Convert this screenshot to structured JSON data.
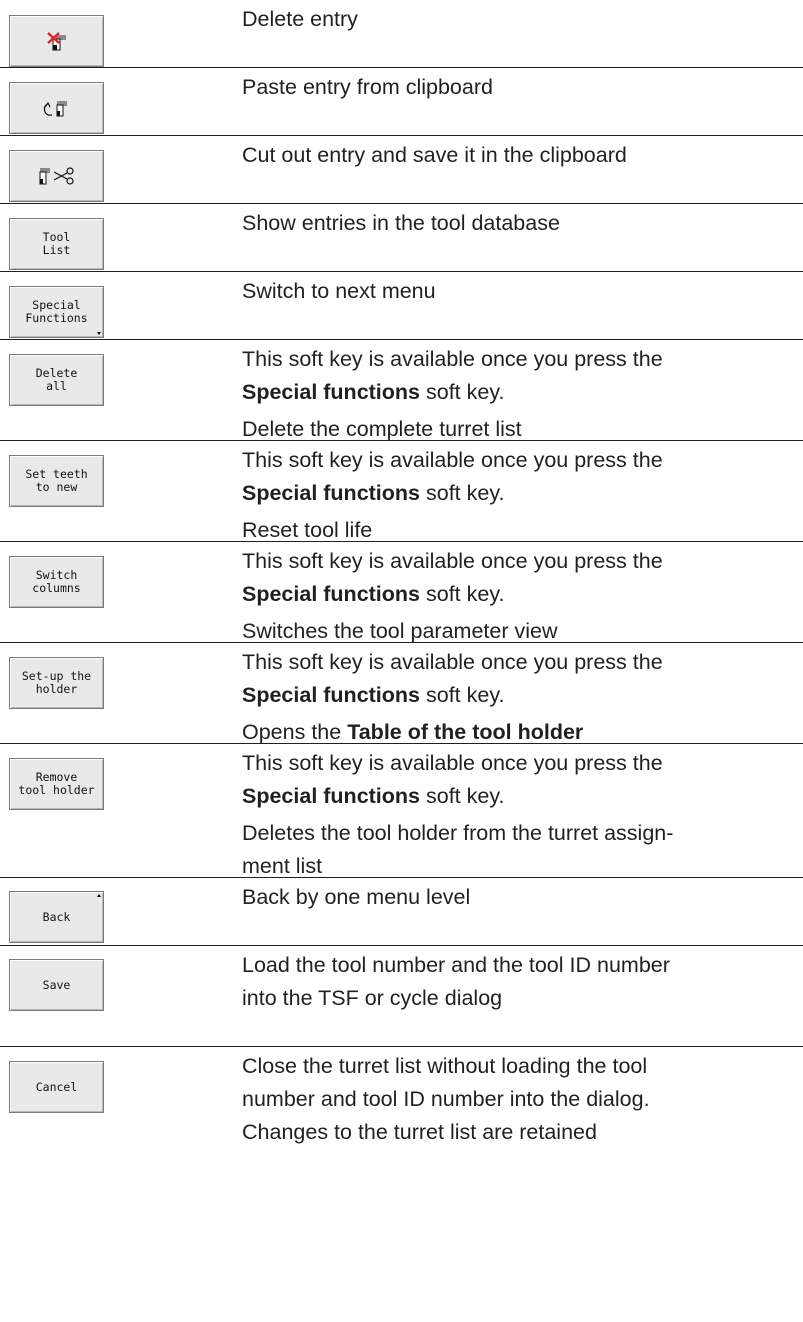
{
  "rows": [
    {
      "key": "delete-entry",
      "softkey": {
        "icon": "delete-entry-icon"
      },
      "paragraphs": [
        [
          {
            "t": "Delete entry"
          }
        ]
      ]
    },
    {
      "key": "paste-entry",
      "softkey": {
        "icon": "paste-from-clipboard-icon"
      },
      "paragraphs": [
        [
          {
            "t": "Paste entry from clipboard"
          }
        ]
      ]
    },
    {
      "key": "cut-entry",
      "softkey": {
        "icon": "cut-to-clipboard-icon"
      },
      "paragraphs": [
        [
          {
            "t": "Cut out entry and save it in the clipboard"
          }
        ]
      ]
    },
    {
      "key": "tool-list",
      "softkey": {
        "label": "Tool\nList"
      },
      "paragraphs": [
        [
          {
            "t": "Show entries in the tool database"
          }
        ]
      ]
    },
    {
      "key": "special-functions",
      "softkey": {
        "label": "Special\nFunctions",
        "marker": "down"
      },
      "paragraphs": [
        [
          {
            "t": "Switch to next menu"
          }
        ]
      ]
    },
    {
      "key": "delete-all",
      "softkey": {
        "label": "Delete\nall"
      },
      "paragraphs": [
        [
          {
            "t": "This soft key is available once you press the"
          },
          {
            "br": true
          },
          {
            "t": "Special functions",
            "b": true
          },
          {
            "t": " soft key."
          }
        ],
        [
          {
            "t": "Delete the complete turret list"
          }
        ]
      ]
    },
    {
      "key": "set-teeth-to-new",
      "softkey": {
        "label": "Set teeth\nto new"
      },
      "paragraphs": [
        [
          {
            "t": "This soft key is available once you press the"
          },
          {
            "br": true
          },
          {
            "t": "Special functions",
            "b": true
          },
          {
            "t": " soft key."
          }
        ],
        [
          {
            "t": "Reset tool life"
          }
        ]
      ]
    },
    {
      "key": "switch-columns",
      "softkey": {
        "label": "Switch\ncolumns"
      },
      "paragraphs": [
        [
          {
            "t": "This soft key is available once you press the"
          },
          {
            "br": true
          },
          {
            "t": "Special functions",
            "b": true
          },
          {
            "t": " soft key."
          }
        ],
        [
          {
            "t": "Switches the tool parameter view"
          }
        ]
      ]
    },
    {
      "key": "set-up-the-holder",
      "softkey": {
        "label": "Set-up the\nholder"
      },
      "paragraphs": [
        [
          {
            "t": "This soft key is available once you press the"
          },
          {
            "br": true
          },
          {
            "t": "Special functions",
            "b": true
          },
          {
            "t": " soft key."
          }
        ],
        [
          {
            "t": "Opens the "
          },
          {
            "t": "Table of the tool holder",
            "b": true
          }
        ]
      ]
    },
    {
      "key": "remove-tool-holder",
      "softkey": {
        "label": "Remove\ntool holder"
      },
      "paragraphs": [
        [
          {
            "t": "This soft key is available once you press the"
          },
          {
            "br": true
          },
          {
            "t": "Special functions",
            "b": true
          },
          {
            "t": " soft key."
          }
        ],
        [
          {
            "t": "Deletes the tool holder from the turret assign-"
          },
          {
            "br": true
          },
          {
            "t": "ment list"
          }
        ]
      ]
    },
    {
      "key": "back",
      "softkey": {
        "label": "Back",
        "marker": "up"
      },
      "paragraphs": [
        [
          {
            "t": "Back by one menu level"
          }
        ]
      ]
    },
    {
      "key": "save",
      "softkey": {
        "label": "Save"
      },
      "paragraphs": [
        [
          {
            "t": "Load the tool number and the tool ID number"
          },
          {
            "br": true
          },
          {
            "t": "into the TSF or cycle dialog"
          }
        ]
      ]
    },
    {
      "key": "cancel",
      "softkey": {
        "label": "Cancel"
      },
      "paragraphs": [
        [
          {
            "t": "Close the turret list without loading the tool"
          },
          {
            "br": true
          },
          {
            "t": "number and tool ID number into the dialog."
          },
          {
            "br": true
          },
          {
            "t": "Changes to the turret list are retained"
          }
        ]
      ]
    }
  ]
}
